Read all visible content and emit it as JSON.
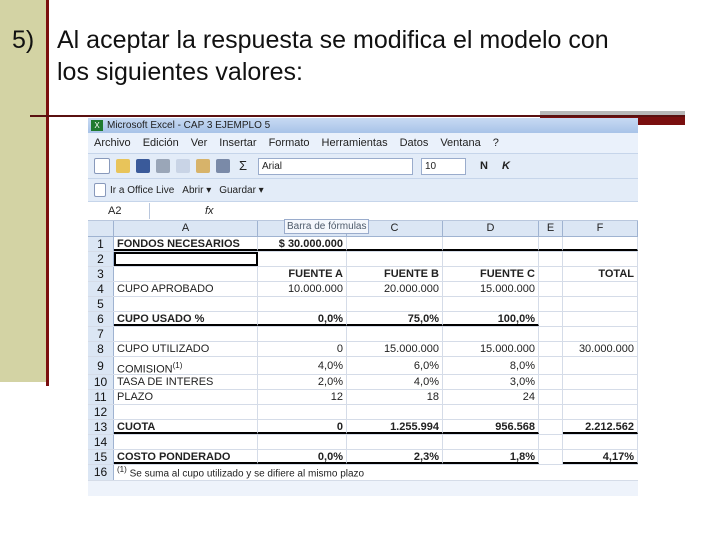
{
  "slide": {
    "number": "5)",
    "line1": "Al aceptar la respuesta se modifica el modelo con",
    "line2": "los siguientes valores:"
  },
  "excel": {
    "window_title": "Microsoft Excel - CAP 3 EJEMPLO 5",
    "menu": [
      "Archivo",
      "Edición",
      "Ver",
      "Insertar",
      "Formato",
      "Herramientas",
      "Datos",
      "Ventana",
      "?"
    ],
    "font_name": "Arial",
    "font_size": "10",
    "bold_btn": "N",
    "italic_btn": "K",
    "toolbar2": [
      "Ir a Office Live",
      "Abrir ▾",
      "Guardar ▾"
    ],
    "name_box": "A2",
    "fx": "fx",
    "tooltip": "Barra de fórmulas",
    "columns": [
      "A",
      "B",
      "C",
      "D",
      "E",
      "F"
    ],
    "rows": [
      [
        "1",
        "FONDOS NECESARIOS",
        "$ 30.000.000",
        "",
        "",
        "",
        ""
      ],
      [
        "2",
        "",
        "",
        "",
        "",
        "",
        ""
      ],
      [
        "3",
        "",
        "FUENTE A",
        "FUENTE B",
        "FUENTE C",
        "",
        "TOTAL"
      ],
      [
        "4",
        "CUPO APROBADO",
        "10.000.000",
        "20.000.000",
        "15.000.000",
        "",
        ""
      ],
      [
        "5",
        "",
        "",
        "",
        "",
        "",
        ""
      ],
      [
        "6",
        "CUPO USADO %",
        "0,0%",
        "75,0%",
        "100,0%",
        "",
        ""
      ],
      [
        "7",
        "",
        "",
        "",
        "",
        "",
        ""
      ],
      [
        "8",
        "CUPO UTILIZADO",
        "0",
        "15.000.000",
        "15.000.000",
        "",
        "30.000.000"
      ],
      [
        "9",
        "COMISION",
        "4,0%",
        "6,0%",
        "8,0%",
        "",
        ""
      ],
      [
        "10",
        "TASA DE INTERES",
        "2,0%",
        "4,0%",
        "3,0%",
        "",
        ""
      ],
      [
        "11",
        "PLAZO",
        "12",
        "18",
        "24",
        "",
        ""
      ],
      [
        "12",
        "",
        "",
        "",
        "",
        "",
        ""
      ],
      [
        "13",
        "CUOTA",
        "0",
        "1.255.994",
        "956.568",
        "",
        "2.212.562"
      ],
      [
        "14",
        "",
        "",
        "",
        "",
        "",
        ""
      ],
      [
        "15",
        "COSTO PONDERADO",
        "0,0%",
        "2,3%",
        "1,8%",
        "",
        "4,17%"
      ]
    ],
    "comision_note_mark": "(1)",
    "footnote_mark": "(1)",
    "footnote": "Se suma al cupo utilizado y se difiere al mismo plazo",
    "footnote_row": "16"
  }
}
